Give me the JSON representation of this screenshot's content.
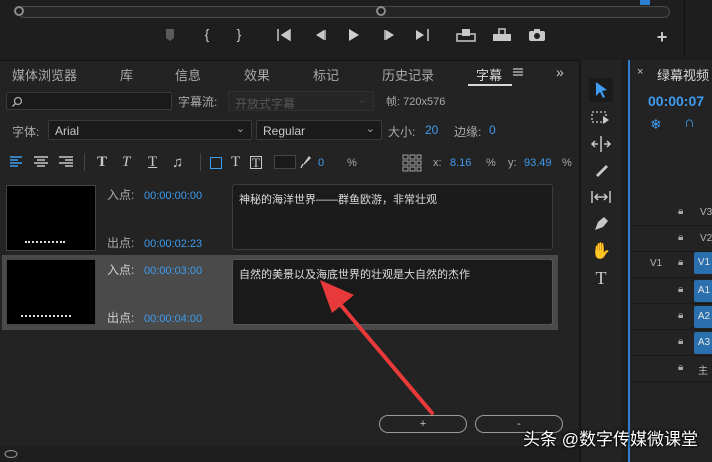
{
  "monitor": {
    "icons": [
      "marker-icon",
      "mark-in-icon",
      "mark-out-icon",
      "go-to-in-icon",
      "step-back-icon",
      "play-icon",
      "step-forward-icon",
      "go-to-out-icon",
      "lift-icon",
      "extract-icon",
      "export-frame-icon",
      "add-button-icon"
    ]
  },
  "tabs": [
    {
      "label": "媒体浏览器"
    },
    {
      "label": "库"
    },
    {
      "label": "信息"
    },
    {
      "label": "效果"
    },
    {
      "label": "标记"
    },
    {
      "label": "历史记录"
    },
    {
      "label": "字幕"
    }
  ],
  "toolbar1": {
    "search_placeholder": "",
    "stream_label": "字幕流:",
    "stream_value": "开放式字幕",
    "frame_label": "帧: 720x576"
  },
  "toolbar2": {
    "font_label": "字体:",
    "font_value": "Arial",
    "style_value": "Regular",
    "size_label": "大小:",
    "size_value": "20",
    "edge_label": "边缘:",
    "edge_value": "0"
  },
  "toolbar3": {
    "opacity_value": "0",
    "opacity_unit": "%",
    "x_label": "x:",
    "x_value": "8.16",
    "x_unit": "%",
    "y_label": "y:",
    "y_value": "93.49",
    "y_unit": "%"
  },
  "captions": [
    {
      "in_label": "入点:",
      "in_time": "00:00:00:00",
      "out_label": "出点:",
      "out_time": "00:00:02:23",
      "text": "神秘的海洋世界——群鱼欧游，非常壮观"
    },
    {
      "in_label": "入点:",
      "in_time": "00:00:03:00",
      "out_label": "出点:",
      "out_time": "00:00:04:00",
      "text": "自然的美景以及海底世界的壮观是大自然的杰作"
    }
  ],
  "buttons": {
    "add_label": "+",
    "remove_label": "-"
  },
  "timeline": {
    "title": "绿幕视频",
    "timecode": "00:00:07",
    "tracks": [
      {
        "name": "V3"
      },
      {
        "name": "V2"
      },
      {
        "name": "V1",
        "source": "V1"
      },
      {
        "name": "A1"
      },
      {
        "name": "A2"
      },
      {
        "name": "A3"
      },
      {
        "name": "主"
      }
    ]
  },
  "watermark": "头条 @数字传媒微课堂",
  "colors": {
    "accent": "#3d9cf0",
    "arrow": "#e83a3a",
    "timeline_border": "#2e7fd2"
  }
}
